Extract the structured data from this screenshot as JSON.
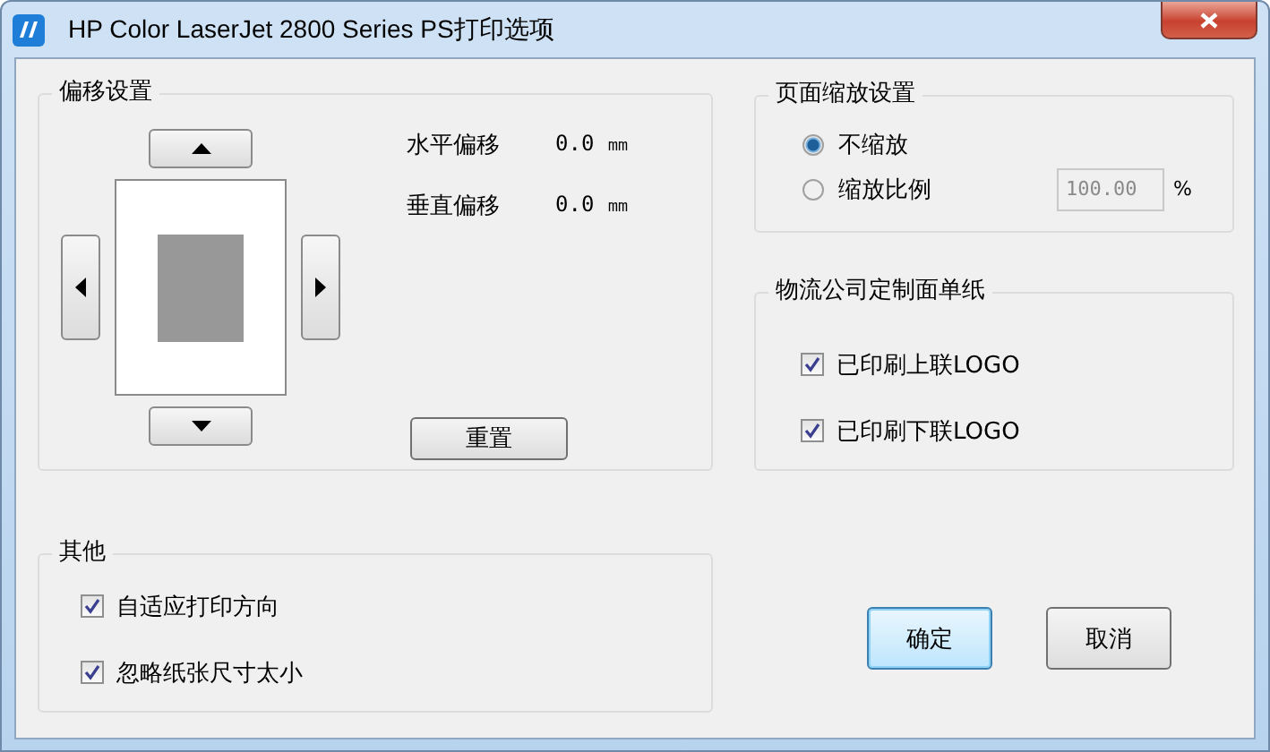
{
  "window": {
    "title": "HP Color LaserJet 2800 Series PS打印选项"
  },
  "offset": {
    "title": "偏移设置",
    "rows": [
      {
        "label": "水平偏移",
        "value": "0.0 ㎜"
      },
      {
        "label": "垂直偏移",
        "value": "0.0 ㎜"
      }
    ],
    "reset": "重置"
  },
  "scale": {
    "title": "页面缩放设置",
    "options": [
      {
        "label": "不缩放",
        "selected": true
      },
      {
        "label": "缩放比例",
        "selected": false
      }
    ],
    "field": {
      "value": "100.00",
      "disabled": true
    },
    "unit": "%"
  },
  "logistics": {
    "title": "物流公司定制面单纸",
    "checks": [
      {
        "label": "已印刷上联LOGO",
        "checked": true
      },
      {
        "label": "已印刷下联LOGO",
        "checked": true
      }
    ]
  },
  "other": {
    "title": "其他",
    "checks": [
      {
        "label": "自适应打印方向",
        "checked": true
      },
      {
        "label": "忽略纸张尺寸太小",
        "checked": true
      }
    ]
  },
  "buttons": [
    {
      "label": "确定",
      "focused": true
    },
    {
      "label": "取消",
      "focused": false
    }
  ]
}
